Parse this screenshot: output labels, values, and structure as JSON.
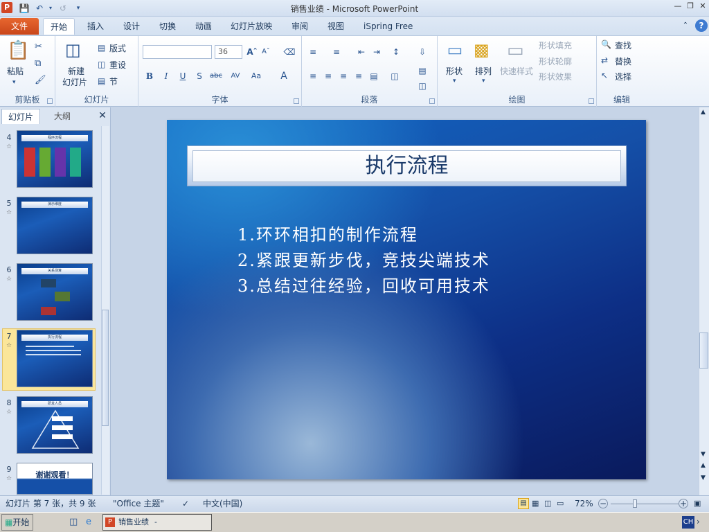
{
  "window": {
    "title": "销售业绩 - Microsoft PowerPoint",
    "app_icon": "P",
    "qat": [
      "save-icon",
      "undo-icon",
      "redo-icon",
      "customize-icon"
    ],
    "controls": [
      "minimize-icon",
      "restore-icon",
      "close-icon"
    ]
  },
  "tabs": {
    "file": "文件",
    "items": [
      "开始",
      "插入",
      "设计",
      "切换",
      "动画",
      "幻灯片放映",
      "审阅",
      "视图",
      "iSpring Free"
    ],
    "help": "?"
  },
  "ribbon": {
    "clipboard": {
      "label": "剪贴板",
      "paste": "粘贴"
    },
    "slides": {
      "label": "幻灯片",
      "new_slide": "新建",
      "new_slide2": "幻灯片",
      "layout": "版式",
      "reset": "重设",
      "section": "节"
    },
    "font": {
      "label": "字体",
      "font_name": "",
      "font_size": "36"
    },
    "paragraph": {
      "label": "段落"
    },
    "drawing": {
      "label": "绘图",
      "shapes": "形状",
      "arrange": "排列",
      "quick_styles": "快速样式",
      "fill": "形状填充",
      "outline": "形状轮廓",
      "effects": "形状效果"
    },
    "editing": {
      "label": "编辑",
      "find": "查找",
      "replace": "替换",
      "select": "选择"
    }
  },
  "panel": {
    "tab_slides": "幻灯片",
    "tab_outline": "大纲",
    "thumbs": [
      {
        "num": "4",
        "title": "程序流程"
      },
      {
        "num": "5",
        "title": "演示维度"
      },
      {
        "num": "6",
        "title": "关系测算"
      },
      {
        "num": "7",
        "title": "执行流程"
      },
      {
        "num": "8",
        "title": "研发人员"
      },
      {
        "num": "9",
        "title": "谢谢观看！"
      }
    ]
  },
  "slide": {
    "title": "执行流程",
    "bullets": [
      "1.环环相扣的制作流程",
      "2.紧跟更新步伐，竞技尖端技术",
      "3.总结过往经验，回收可用技术"
    ]
  },
  "status": {
    "slide_info": "幻灯片 第 7 张，共 9 张",
    "theme": "\"Office 主题\"",
    "language": "中文(中国)",
    "zoom": "72%",
    "zoom_fraction": 0.72
  },
  "taskbar": {
    "start": "开始",
    "task": "销售业绩 - Microsof...",
    "ime": "CH"
  }
}
